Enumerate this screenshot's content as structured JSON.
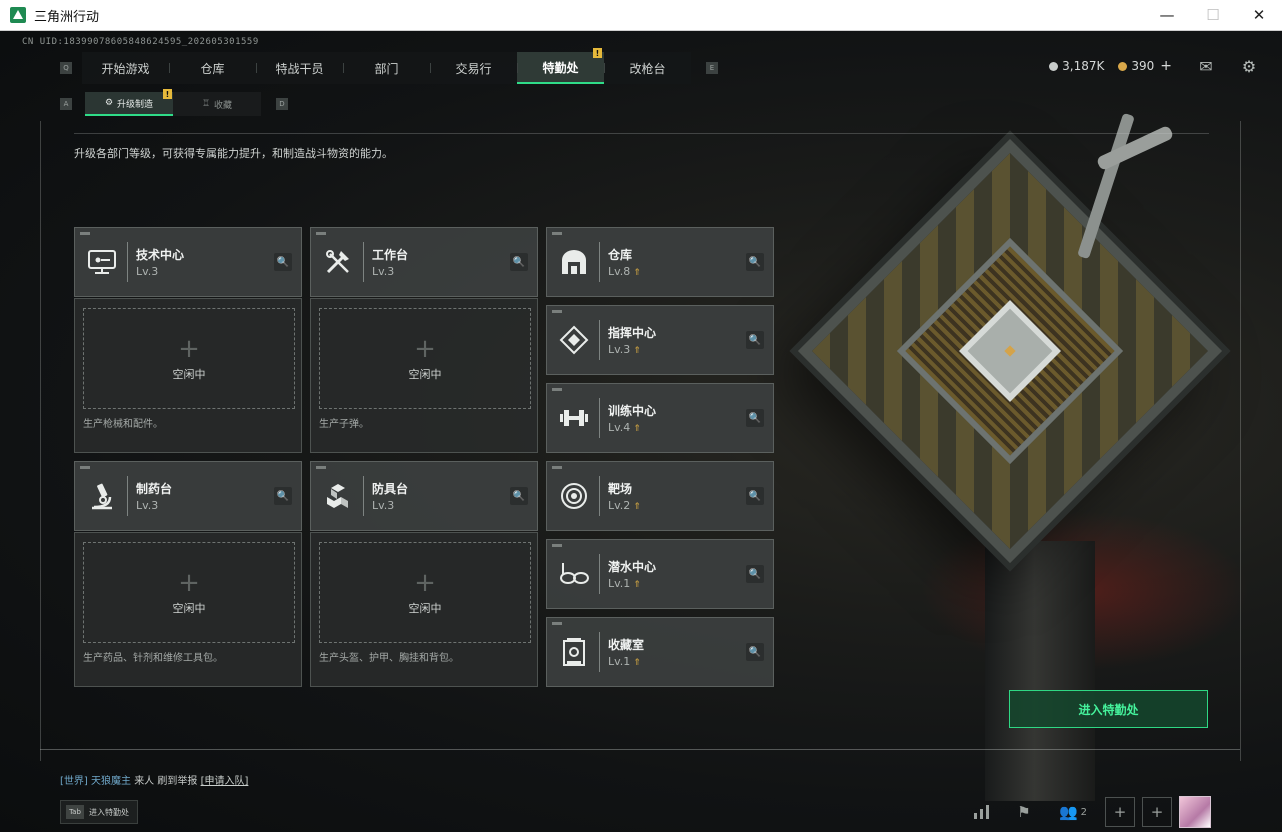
{
  "window": {
    "title": "三角洲行动",
    "minimize": "—",
    "maximize": "☐",
    "close": "✕"
  },
  "uid": "CN UID:1839907860584862459­5_202605301559",
  "nav": {
    "key_left": "Q",
    "key_right": "E",
    "tabs": [
      {
        "label": "开始游戏",
        "active": false
      },
      {
        "label": "仓库",
        "active": false
      },
      {
        "label": "特战干员",
        "active": false
      },
      {
        "label": "部门",
        "active": false
      },
      {
        "label": "交易行",
        "active": false
      },
      {
        "label": "特勤处",
        "active": true,
        "badge": "!"
      },
      {
        "label": "改枪台",
        "active": false
      }
    ]
  },
  "currency": {
    "silver": "3,187K",
    "gold": "390",
    "plus": "+",
    "silver_color": "#c8ccca",
    "gold_color": "#d9a84a"
  },
  "subtabs": {
    "key_left": "A",
    "key_right": "D",
    "items": [
      {
        "label": "升级制造",
        "active": true,
        "badge": "!"
      },
      {
        "label": "收藏",
        "active": false
      }
    ]
  },
  "description": "升级各部门等级，可获得专属能力提升，和制造战斗物资的能力。",
  "idle_label": "空闲中",
  "workshops": [
    {
      "name": "技术中心",
      "level": "Lv.3",
      "icon": "monitor-icon",
      "slot_desc": "生产枪械和配件。"
    },
    {
      "name": "工作台",
      "level": "Lv.3",
      "icon": "tools-icon",
      "slot_desc": "生产子弹。"
    },
    {
      "name": "制药台",
      "level": "Lv.3",
      "icon": "microscope-icon",
      "slot_desc": "生产药品、针剂和维修工具包。"
    },
    {
      "name": "防具台",
      "level": "Lv.3",
      "icon": "cubes-icon",
      "slot_desc": "生产头盔、护甲、胸挂和背包。"
    }
  ],
  "departments": [
    {
      "name": "仓库",
      "level": "Lv.8",
      "icon": "warehouse-icon",
      "upgradable": true
    },
    {
      "name": "指挥中心",
      "level": "Lv.3",
      "icon": "command-icon",
      "upgradable": true
    },
    {
      "name": "训练中心",
      "level": "Lv.4",
      "icon": "dumbbell-icon",
      "upgradable": true
    },
    {
      "name": "靶场",
      "level": "Lv.2",
      "icon": "target-icon",
      "upgradable": true
    },
    {
      "name": "潜水中心",
      "level": "Lv.1",
      "icon": "goggles-icon",
      "upgradable": true
    },
    {
      "name": "收藏室",
      "level": "Lv.1",
      "icon": "vault-icon",
      "upgradable": true
    }
  ],
  "enter_button": "进入特勤处",
  "chat": {
    "channel": "[世界]",
    "sender": "天狼魔主",
    "message": "来人  刷到举报",
    "link": "[申请入队]"
  },
  "tab_hint": {
    "key": "Tab",
    "label": "进入特勤处"
  },
  "team_count": "2",
  "accent_color": "#2fdc88"
}
